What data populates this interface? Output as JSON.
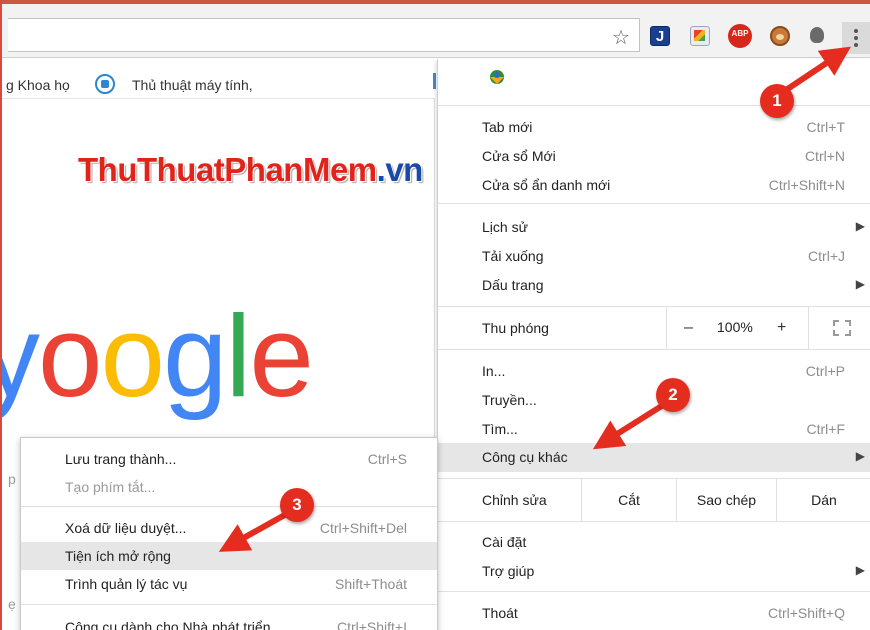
{
  "toolbar": {
    "extensions": [
      "bookmark-star-icon",
      "j-extension-icon",
      "pdf-extension-icon",
      "adblock-plus-icon",
      "tampermonkey-icon",
      "lightbulb-icon"
    ],
    "abp_label": "ABP",
    "j_label": "J",
    "menu_icon": "three-dots-vertical-icon"
  },
  "bookmarks": {
    "item1": "g Khoa họ",
    "item2": "Thủ thuật máy tính,"
  },
  "page": {
    "watermark_main": "ThuThuatPhanMem",
    "watermark_suffix": ".vn",
    "google_letters": [
      "o",
      "o",
      "g",
      "l",
      "e"
    ],
    "google_partial": "y",
    "edge_text_1": "p",
    "edge_text_2": "ẹ"
  },
  "menu": {
    "group1": [
      {
        "label": "Tab mới",
        "shortcut": "Ctrl+T"
      },
      {
        "label": "Cửa sổ Mới",
        "shortcut": "Ctrl+N"
      },
      {
        "label": "Cửa sổ ẩn danh mới",
        "shortcut": "Ctrl+Shift+N"
      }
    ],
    "group2": [
      {
        "label": "Lịch sử",
        "shortcut": ""
      },
      {
        "label": "Tải xuống",
        "shortcut": "Ctrl+J"
      },
      {
        "label": "Dấu trang",
        "shortcut": ""
      }
    ],
    "zoom": {
      "label": "Thu phóng",
      "minus": "–",
      "value": "100%",
      "plus": "+"
    },
    "group3": [
      {
        "label": "In...",
        "shortcut": "Ctrl+P"
      },
      {
        "label": "Truyền...",
        "shortcut": ""
      },
      {
        "label": "Tìm...",
        "shortcut": "Ctrl+F"
      },
      {
        "label": "Công cụ khác",
        "shortcut": ""
      }
    ],
    "edit": {
      "label": "Chỉnh sửa",
      "cut": "Cắt",
      "copy": "Sao chép",
      "paste": "Dán"
    },
    "group4": [
      {
        "label": "Cài đặt",
        "shortcut": ""
      },
      {
        "label": "Trợ giúp",
        "shortcut": ""
      }
    ],
    "exit": {
      "label": "Thoát",
      "shortcut": "Ctrl+Shift+Q"
    },
    "arrow_glyph": "▶"
  },
  "submenu": {
    "items": [
      {
        "label": "Lưu trang thành...",
        "shortcut": "Ctrl+S"
      },
      {
        "label": "Tạo phím tắt...",
        "shortcut": ""
      },
      {
        "label": "Xoá dữ liệu duyệt...",
        "shortcut": "Ctrl+Shift+Del"
      },
      {
        "label": "Tiện ích mở rộng",
        "shortcut": ""
      },
      {
        "label": "Trình quản lý tác vụ",
        "shortcut": "Shift+Thoát"
      },
      {
        "label": "Công cụ dành cho Nhà phát triển",
        "shortcut": "Ctrl+Shift+I"
      }
    ]
  },
  "annotations": {
    "badge1": "1",
    "badge2": "2",
    "badge3": "3",
    "color": "#e42d1f"
  }
}
